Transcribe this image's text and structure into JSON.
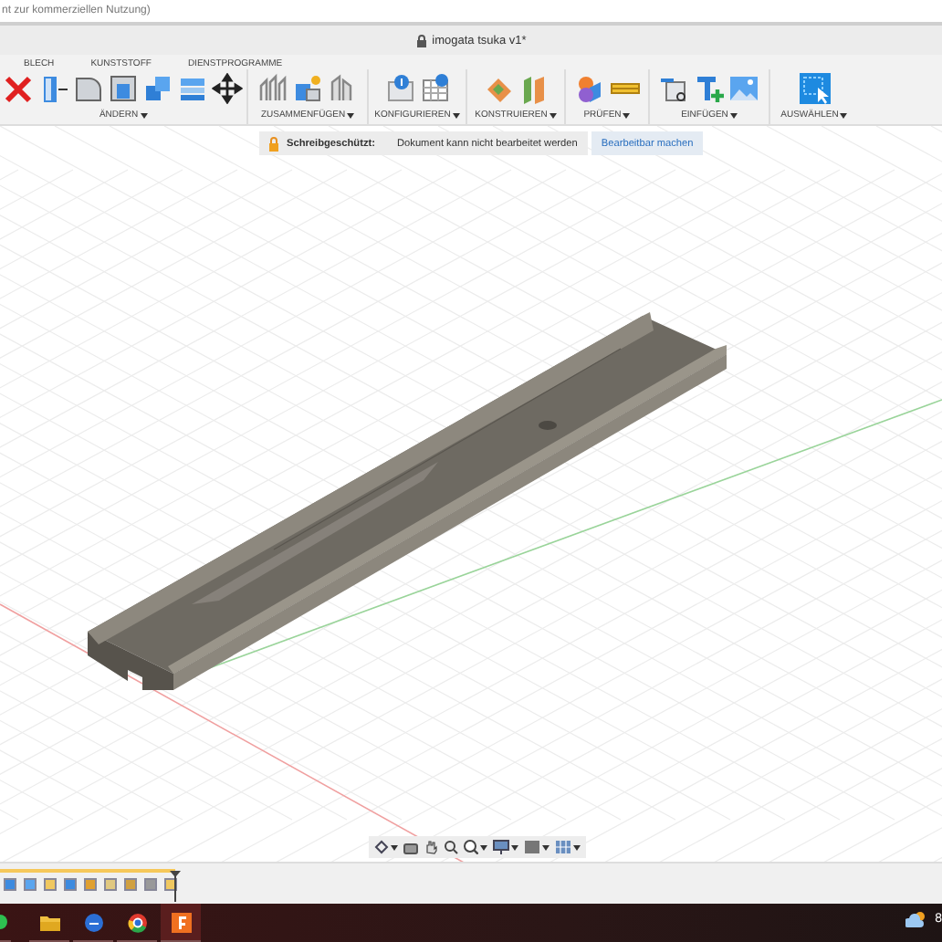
{
  "notice": "nt zur kommerziellen Nutzung)",
  "window": {
    "title": "imogata tsuka v1*"
  },
  "tabs": [
    {
      "label": "BLECH",
      "selected": false
    },
    {
      "label": "KUNSTSTOFF",
      "selected": false
    },
    {
      "label": "DIENSTPROGRAMME",
      "selected": false
    }
  ],
  "ribbon_groups": [
    {
      "label": "ÄNDERN"
    },
    {
      "label": "ZUSAMMENFÜGEN"
    },
    {
      "label": "KONFIGURIEREN"
    },
    {
      "label": "KONSTRUIEREN"
    },
    {
      "label": "PRÜFEN"
    },
    {
      "label": "EINFÜGEN"
    },
    {
      "label": "AUSWÄHLEN"
    }
  ],
  "banner": {
    "label": "Schreibgeschützt:",
    "message": "Dokument kann nicht bearbeitet werden",
    "action": "Bearbeitbar machen"
  },
  "taskbar": {
    "clock": "8"
  }
}
